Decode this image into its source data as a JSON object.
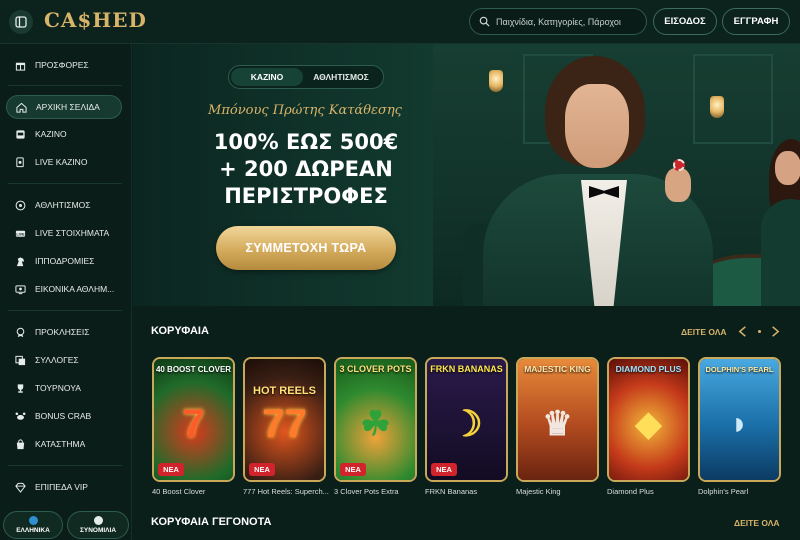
{
  "header": {
    "logo_text": "CA$HED",
    "search_placeholder": "Παιχνίδια, Κατηγορίες, Πάροχοι",
    "login_label": "ΕΙΣΟΔΟΣ",
    "register_label": "ΕΓΓΡΑΦΗ"
  },
  "sidebar": {
    "items": [
      {
        "label": "ΠΡΟΣΦΟΡΕΣ",
        "icon": "gift-icon"
      },
      {
        "label": "ΑΡΧΙΚΗ ΣΕΛΙΔΑ",
        "icon": "home-icon",
        "active": true
      },
      {
        "label": "ΚΑΖΙΝΟ",
        "icon": "slot-icon"
      },
      {
        "label": "LIVE ΚΑΖΙΝΟ",
        "icon": "live-casino-icon"
      },
      {
        "label": "ΑΘΛΗΤΙΣΜΟΣ",
        "icon": "soccer-icon"
      },
      {
        "label": "LIVE ΣΤΟΙΧΗΜΑΤΑ",
        "icon": "live-bet-icon"
      },
      {
        "label": "ΙΠΠΟΔΡΟΜΙΕΣ",
        "icon": "horse-icon"
      },
      {
        "label": "ΕΙΚΟΝΙΚΑ ΑΘΛΗΜ...",
        "icon": "virtual-sports-icon"
      },
      {
        "label": "ΠΡΟΚΛΗΣΕΙΣ",
        "icon": "challenge-icon"
      },
      {
        "label": "ΣΥΛΛΟΓΕΣ",
        "icon": "collections-icon"
      },
      {
        "label": "ΤΟΥΡΝΟΥΑ",
        "icon": "trophy-icon"
      },
      {
        "label": "BONUS CRAB",
        "icon": "crab-icon"
      },
      {
        "label": "ΚΑΤΑΣΤΗΜΑ",
        "icon": "shop-icon"
      },
      {
        "label": "ΕΠΙΠΕΔΑ VIP",
        "icon": "diamond-icon"
      }
    ],
    "language_label": "ΕΛΛΗΝΙΚΑ",
    "support_label": "ΣΥΝΟΜΙΛΙΑ"
  },
  "hero": {
    "tabs": [
      "ΚΑΖΙΝΟ",
      "ΑΘΛΗΤΙΣΜΟΣ"
    ],
    "active_tab": "ΚΑΖΙΝΟ",
    "script_line": "Μπόνους Πρώτης Κατάθεσης",
    "headline_1": "100% ΕΩΣ 500€",
    "headline_2": "+ 200 ΔΩΡΕΑΝ",
    "headline_3": "ΠΕΡΙΣΤΡΟΦΕΣ",
    "cta_label": "ΣΥΜΜΕΤΟΧΗ ΤΩΡΑ"
  },
  "top_games": {
    "title": "ΚΟΡΥΦΑΙΑ",
    "see_all": "ΔΕΙΤΕ ΟΛΑ",
    "new_badge": "ΝΕΑ",
    "games": [
      {
        "name": "40 Boost Clover",
        "art_title": "40 BOOST CLOVER",
        "new": true,
        "color": "#1f6b2a"
      },
      {
        "name": "777 Hot Reels: Superch...",
        "art_title": "HOT REELS",
        "new": true,
        "color": "#3a1f14"
      },
      {
        "name": "3 Clover Pots Extra",
        "art_title": "3 CLOVER POTS",
        "new": true,
        "color": "#2f8a2f"
      },
      {
        "name": "FRKN Bananas",
        "art_title": "FRKN BANANAS",
        "new": true,
        "color": "#1c1233"
      },
      {
        "name": "Majestic King",
        "art_title": "MAJESTIC KING",
        "new": false,
        "color": "#b24a1f"
      },
      {
        "name": "Diamond Plus",
        "art_title": "DIAMOND PLUS",
        "new": false,
        "color": "#8a1b14"
      },
      {
        "name": "Dolphin's Pearl",
        "art_title": "DOLPHIN'S PEARL",
        "new": false,
        "color": "#1a6fa8"
      }
    ]
  },
  "top_events": {
    "title": "ΚΟΡΥΦΑΙΑ ΓΕΓΟΝΟΤΑ",
    "see_all": "ΔΕΙΤΕ ΟΛΑ"
  },
  "colors": {
    "accent_gold": "#d6b26a",
    "background": "#0b1f1a",
    "new_badge": "#d1232b"
  }
}
